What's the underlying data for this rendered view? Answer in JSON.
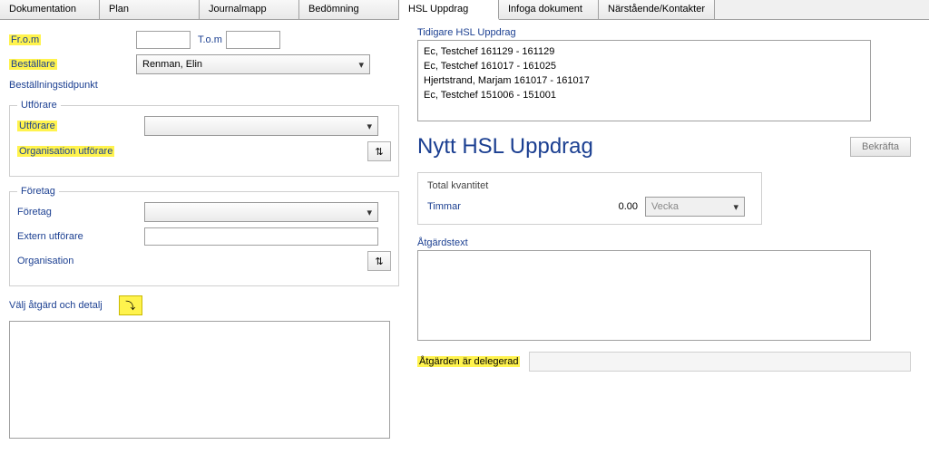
{
  "tabs": [
    {
      "label": "Dokumentation"
    },
    {
      "label": "Plan"
    },
    {
      "label": "Journalmapp"
    },
    {
      "label": "Bedömning"
    },
    {
      "label": "HSL Uppdrag",
      "active": true
    },
    {
      "label": "Infoga dokument"
    },
    {
      "label": "Närstående/Kontakter"
    }
  ],
  "left": {
    "from_label": "Fr.o.m",
    "to_label": "T.o.m",
    "from_value": "",
    "to_value": "",
    "bestallare_label": "Beställare",
    "bestallare_value": "Renman, Elin",
    "bestallningstidpunkt_label": "Beställningstidpunkt",
    "utforare_legend": "Utförare",
    "utforare_label": "Utförare",
    "utforare_value": "",
    "org_utforare_label": "Organisation utförare",
    "foretag_legend": "Företag",
    "foretag_label": "Företag",
    "foretag_value": "",
    "extern_utforare_label": "Extern utförare",
    "extern_utforare_value": "",
    "organisation_label": "Organisation",
    "valj_atgard_label": "Välj åtgärd och detalj"
  },
  "right": {
    "tidigare_label": "Tidigare HSL Uppdrag",
    "list": [
      "Ec, Testchef  161129 - 161129",
      "Ec, Testchef  161017 - 161025",
      "Hjertstrand, Marjam  161017 - 161017",
      "Ec, Testchef  151006 - 151001"
    ],
    "title": "Nytt HSL Uppdrag",
    "bekrafta_label": "Bekräfta",
    "total_kvantitet_label": "Total kvantitet",
    "timmar_label": "Timmar",
    "timmar_value": "0.00",
    "period_value": "Vecka",
    "atgardstext_label": "Åtgärdstext",
    "delegerad_label": "Åtgärden är delegerad"
  }
}
